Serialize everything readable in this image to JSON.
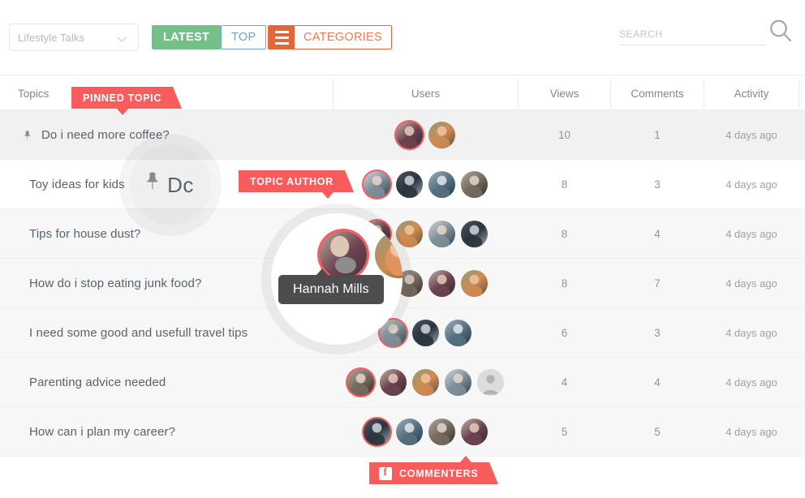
{
  "toolbar": {
    "category_select": {
      "value": "Lifestyle Talks",
      "icon": "chevron-down-icon"
    },
    "latest_label": "LATEST",
    "top_label": "TOP",
    "categories_label": "CATEGORIES",
    "search_placeholder": "SEARCH",
    "search_value": "",
    "search_icon": "search-icon",
    "colors": {
      "latest_bg": "#73c088",
      "top_border": "#6ba3d6",
      "categories_accent": "#e2663a",
      "categories_text": "#f07a50"
    }
  },
  "table": {
    "headers": [
      "Topics",
      "Users",
      "Views",
      "Comments",
      "Activity"
    ],
    "rows": [
      {
        "topic": "Do i need more coffee?",
        "pinned": true,
        "pin_icon": "pushpin-icon",
        "views": "10",
        "comments": "1",
        "activity": "4 days ago",
        "avatars": 2,
        "placeholder_last": false
      },
      {
        "topic": "Toy ideas for kids",
        "pinned": false,
        "views": "8",
        "comments": "3",
        "activity": "4 days ago",
        "avatars": 4,
        "placeholder_last": false
      },
      {
        "topic": "Tips for house dust?",
        "pinned": false,
        "views": "8",
        "comments": "4",
        "activity": "4 days ago",
        "avatars": 4,
        "placeholder_last": false
      },
      {
        "topic": "How do i stop eating junk food?",
        "pinned": false,
        "views": "8",
        "comments": "7",
        "activity": "4 days ago",
        "avatars": 4,
        "placeholder_last": false
      },
      {
        "topic": "I need some good and usefull travel tips",
        "pinned": false,
        "views": "6",
        "comments": "3",
        "activity": "4 days ago",
        "avatars": 3,
        "placeholder_last": false
      },
      {
        "topic": "Parenting advice needed",
        "pinned": false,
        "views": "4",
        "comments": "4",
        "activity": "4 days ago",
        "avatars": 5,
        "placeholder_last": true
      },
      {
        "topic": "How can i plan my career?",
        "pinned": false,
        "views": "5",
        "comments": "5",
        "activity": "4 days ago",
        "avatars": 4,
        "placeholder_last": false
      }
    ]
  },
  "annotations": {
    "pinned_topic_flag": "PINNED TOPIC",
    "topic_author_flag": "TOPIC AUTHOR",
    "commenters_flag": "COMMENTERS",
    "commenters_icon": "facebook-icon",
    "flag_color": "#f95c5c"
  },
  "magnifier": {
    "small_lens_text": "Dc",
    "small_lens_icon": "pushpin-icon",
    "tooltip_name": "Hannah Mills",
    "tooltip_bg": "#4d4d4d"
  }
}
